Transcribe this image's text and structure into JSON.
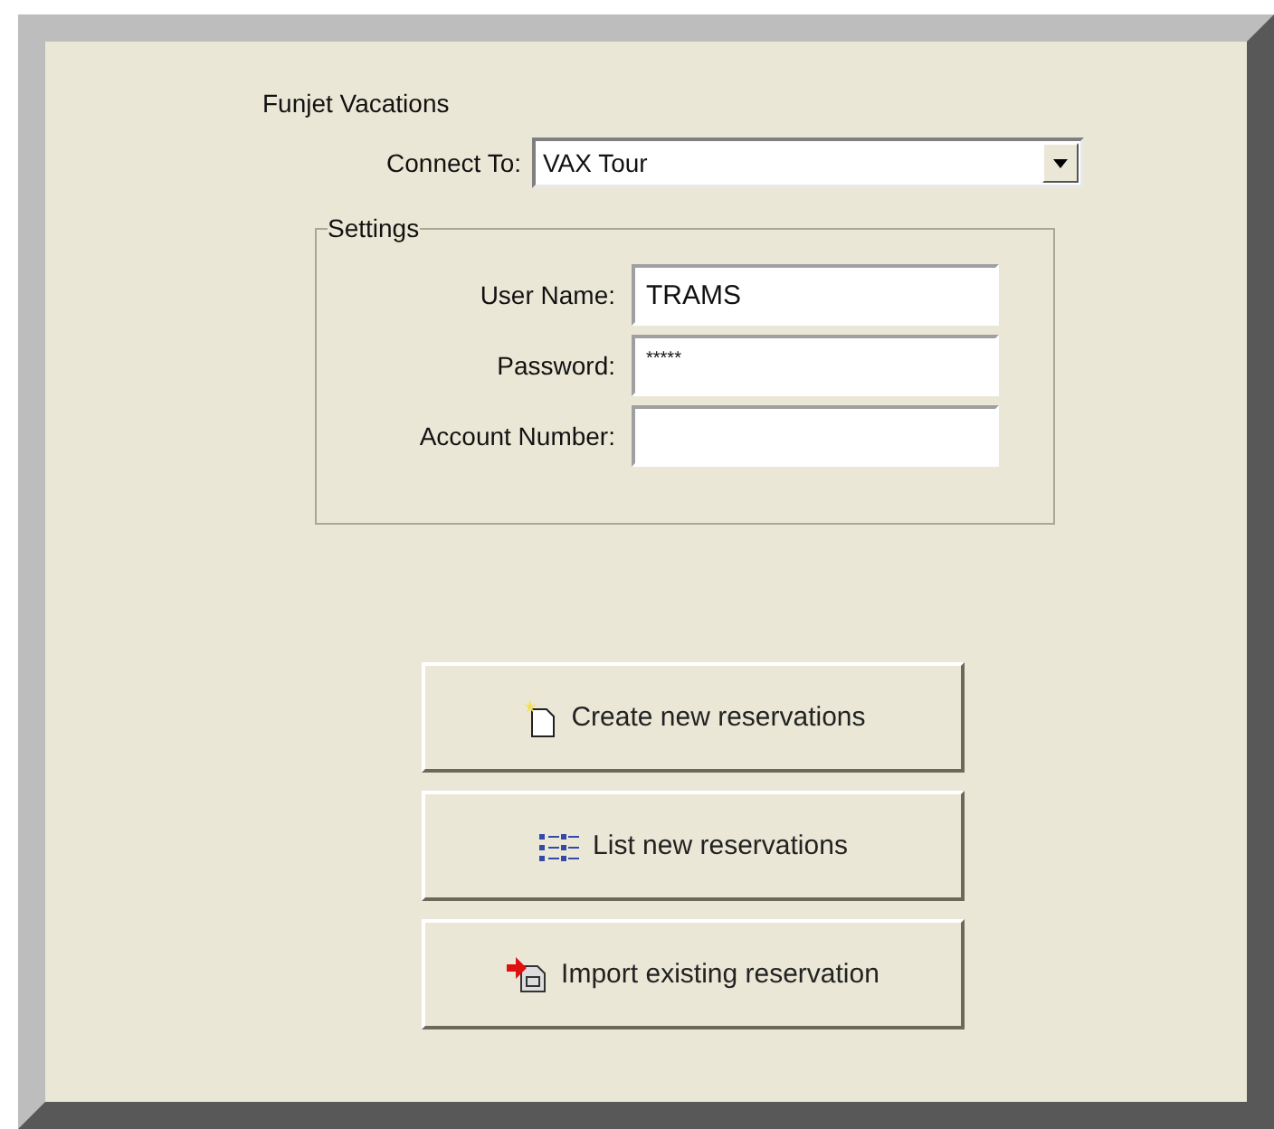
{
  "title": "Funjet Vacations",
  "connect": {
    "label": "Connect To:",
    "value": "VAX Tour"
  },
  "settings": {
    "legend": "Settings",
    "fields": [
      {
        "label": "User Name:",
        "value": "TRAMS"
      },
      {
        "label": "Password:",
        "value": "*****"
      },
      {
        "label": "Account Number:"
      }
    ]
  },
  "buttons": [
    {
      "kind": "create",
      "label": "Create new reservations"
    },
    {
      "kind": "list",
      "label": "List new reservations"
    },
    {
      "kind": "import",
      "label": "Import existing reservation"
    }
  ]
}
